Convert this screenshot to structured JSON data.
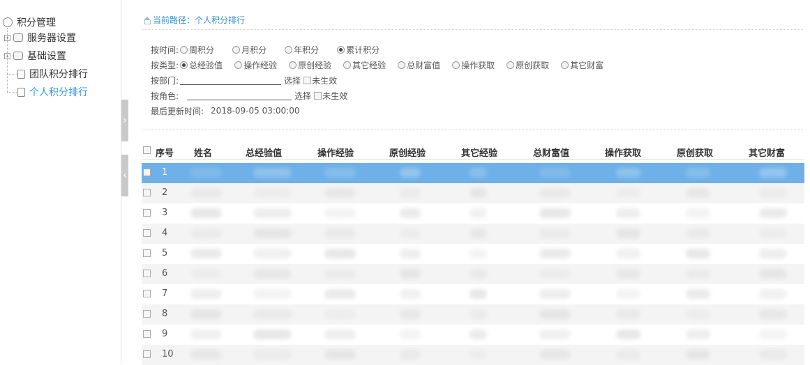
{
  "sidebar": {
    "root": {
      "label": "积分管理",
      "icon": "tree-root-icon"
    },
    "items": [
      {
        "label": "服务器设置",
        "icon": "folder-icon",
        "expandable": true
      },
      {
        "label": "基础设置",
        "icon": "folder-icon",
        "expandable": true
      },
      {
        "label": "团队积分排行",
        "icon": "document-icon",
        "expandable": false
      },
      {
        "label": "个人积分排行",
        "icon": "document-icon",
        "expandable": false,
        "active": true
      }
    ],
    "expander_glyph": "+"
  },
  "splitter": {
    "top_arrow": "›",
    "bottom_arrow": "‹"
  },
  "breadcrumb": {
    "prefix": "当前路径：",
    "current": "个人积分排行"
  },
  "filters": {
    "time": {
      "label": "按时间:",
      "options": [
        "周积分",
        "月积分",
        "年积分",
        "累计积分"
      ],
      "selected": "累计积分"
    },
    "type": {
      "label": "按类型:",
      "options": [
        "总经验值",
        "操作经验",
        "原创经验",
        "其它经验",
        "总财富值",
        "操作获取",
        "原创获取",
        "其它财富"
      ],
      "selected": "总经验值"
    },
    "department": {
      "label": "按部门:",
      "value": "",
      "choose_label": "选择",
      "inactive_label": "未生效"
    },
    "role": {
      "label": "按角色:",
      "value": "",
      "choose_label": "选择",
      "inactive_label": "未生效"
    },
    "last_update": {
      "label": "最后更新时间:",
      "value": "2018-09-05 03:00:00"
    }
  },
  "table": {
    "columns": [
      "序号",
      "姓名",
      "总经验值",
      "操作经验",
      "原创经验",
      "其它经验",
      "总财富值",
      "操作获取",
      "原创获取",
      "其它财富"
    ],
    "rows": [
      {
        "index": "1",
        "selected": true
      },
      {
        "index": "2"
      },
      {
        "index": "3"
      },
      {
        "index": "4"
      },
      {
        "index": "5"
      },
      {
        "index": "6"
      },
      {
        "index": "7"
      },
      {
        "index": "8"
      },
      {
        "index": "9"
      },
      {
        "index": "10"
      }
    ]
  },
  "colors": {
    "accent": "#3a8fc8",
    "selected_row": "#6fb0e8",
    "alt_row": "#f4f4f4",
    "splitter": "#c9c9c9"
  }
}
